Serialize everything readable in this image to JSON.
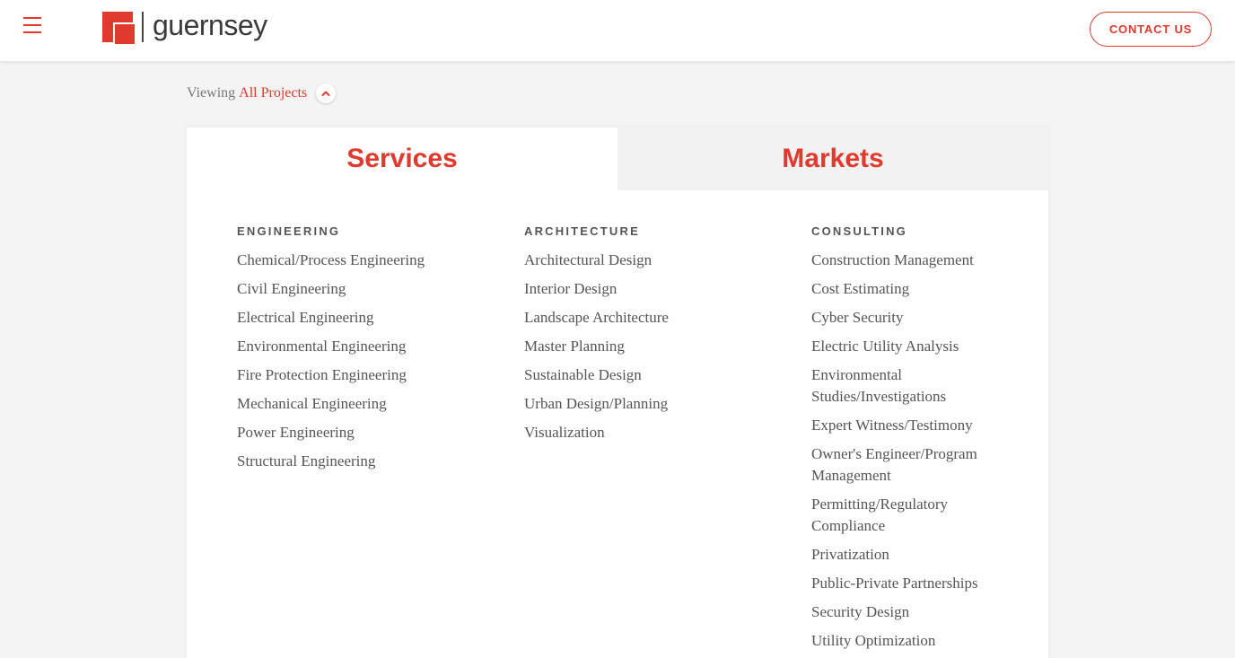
{
  "header": {
    "logo_text": "guernsey",
    "contact_label": "CONTACT US"
  },
  "viewing": {
    "prefix": "Viewing",
    "filter": "All Projects"
  },
  "tabs": [
    {
      "label": "Services",
      "active": true
    },
    {
      "label": "Markets",
      "active": false
    }
  ],
  "columns": [
    {
      "heading": "ENGINEERING",
      "items": [
        "Chemical/Process Engineering",
        "Civil Engineering",
        "Electrical Engineering",
        "Environmental Engineering",
        "Fire Protection Engineering",
        "Mechanical Engineering",
        "Power Engineering",
        "Structural Engineering"
      ]
    },
    {
      "heading": "ARCHITECTURE",
      "items": [
        "Architectural Design",
        "Interior Design",
        "Landscape Architecture",
        "Master Planning",
        "Sustainable Design",
        "Urban Design/Planning",
        "Visualization"
      ]
    },
    {
      "heading": "CONSULTING",
      "items": [
        "Construction Management",
        "Cost Estimating",
        "Cyber Security",
        "Electric Utility Analysis",
        "Environmental Studies/Investigations",
        "Expert Witness/Testimony",
        "Owner's Engineer/Program Management",
        "Permitting/Regulatory Compliance",
        "Privatization",
        "Public-Private Partnerships",
        "Security Design",
        "Utility Optimization"
      ]
    }
  ],
  "colors": {
    "accent": "#e03a2e",
    "text": "#555555",
    "background": "#f4f4f4"
  }
}
